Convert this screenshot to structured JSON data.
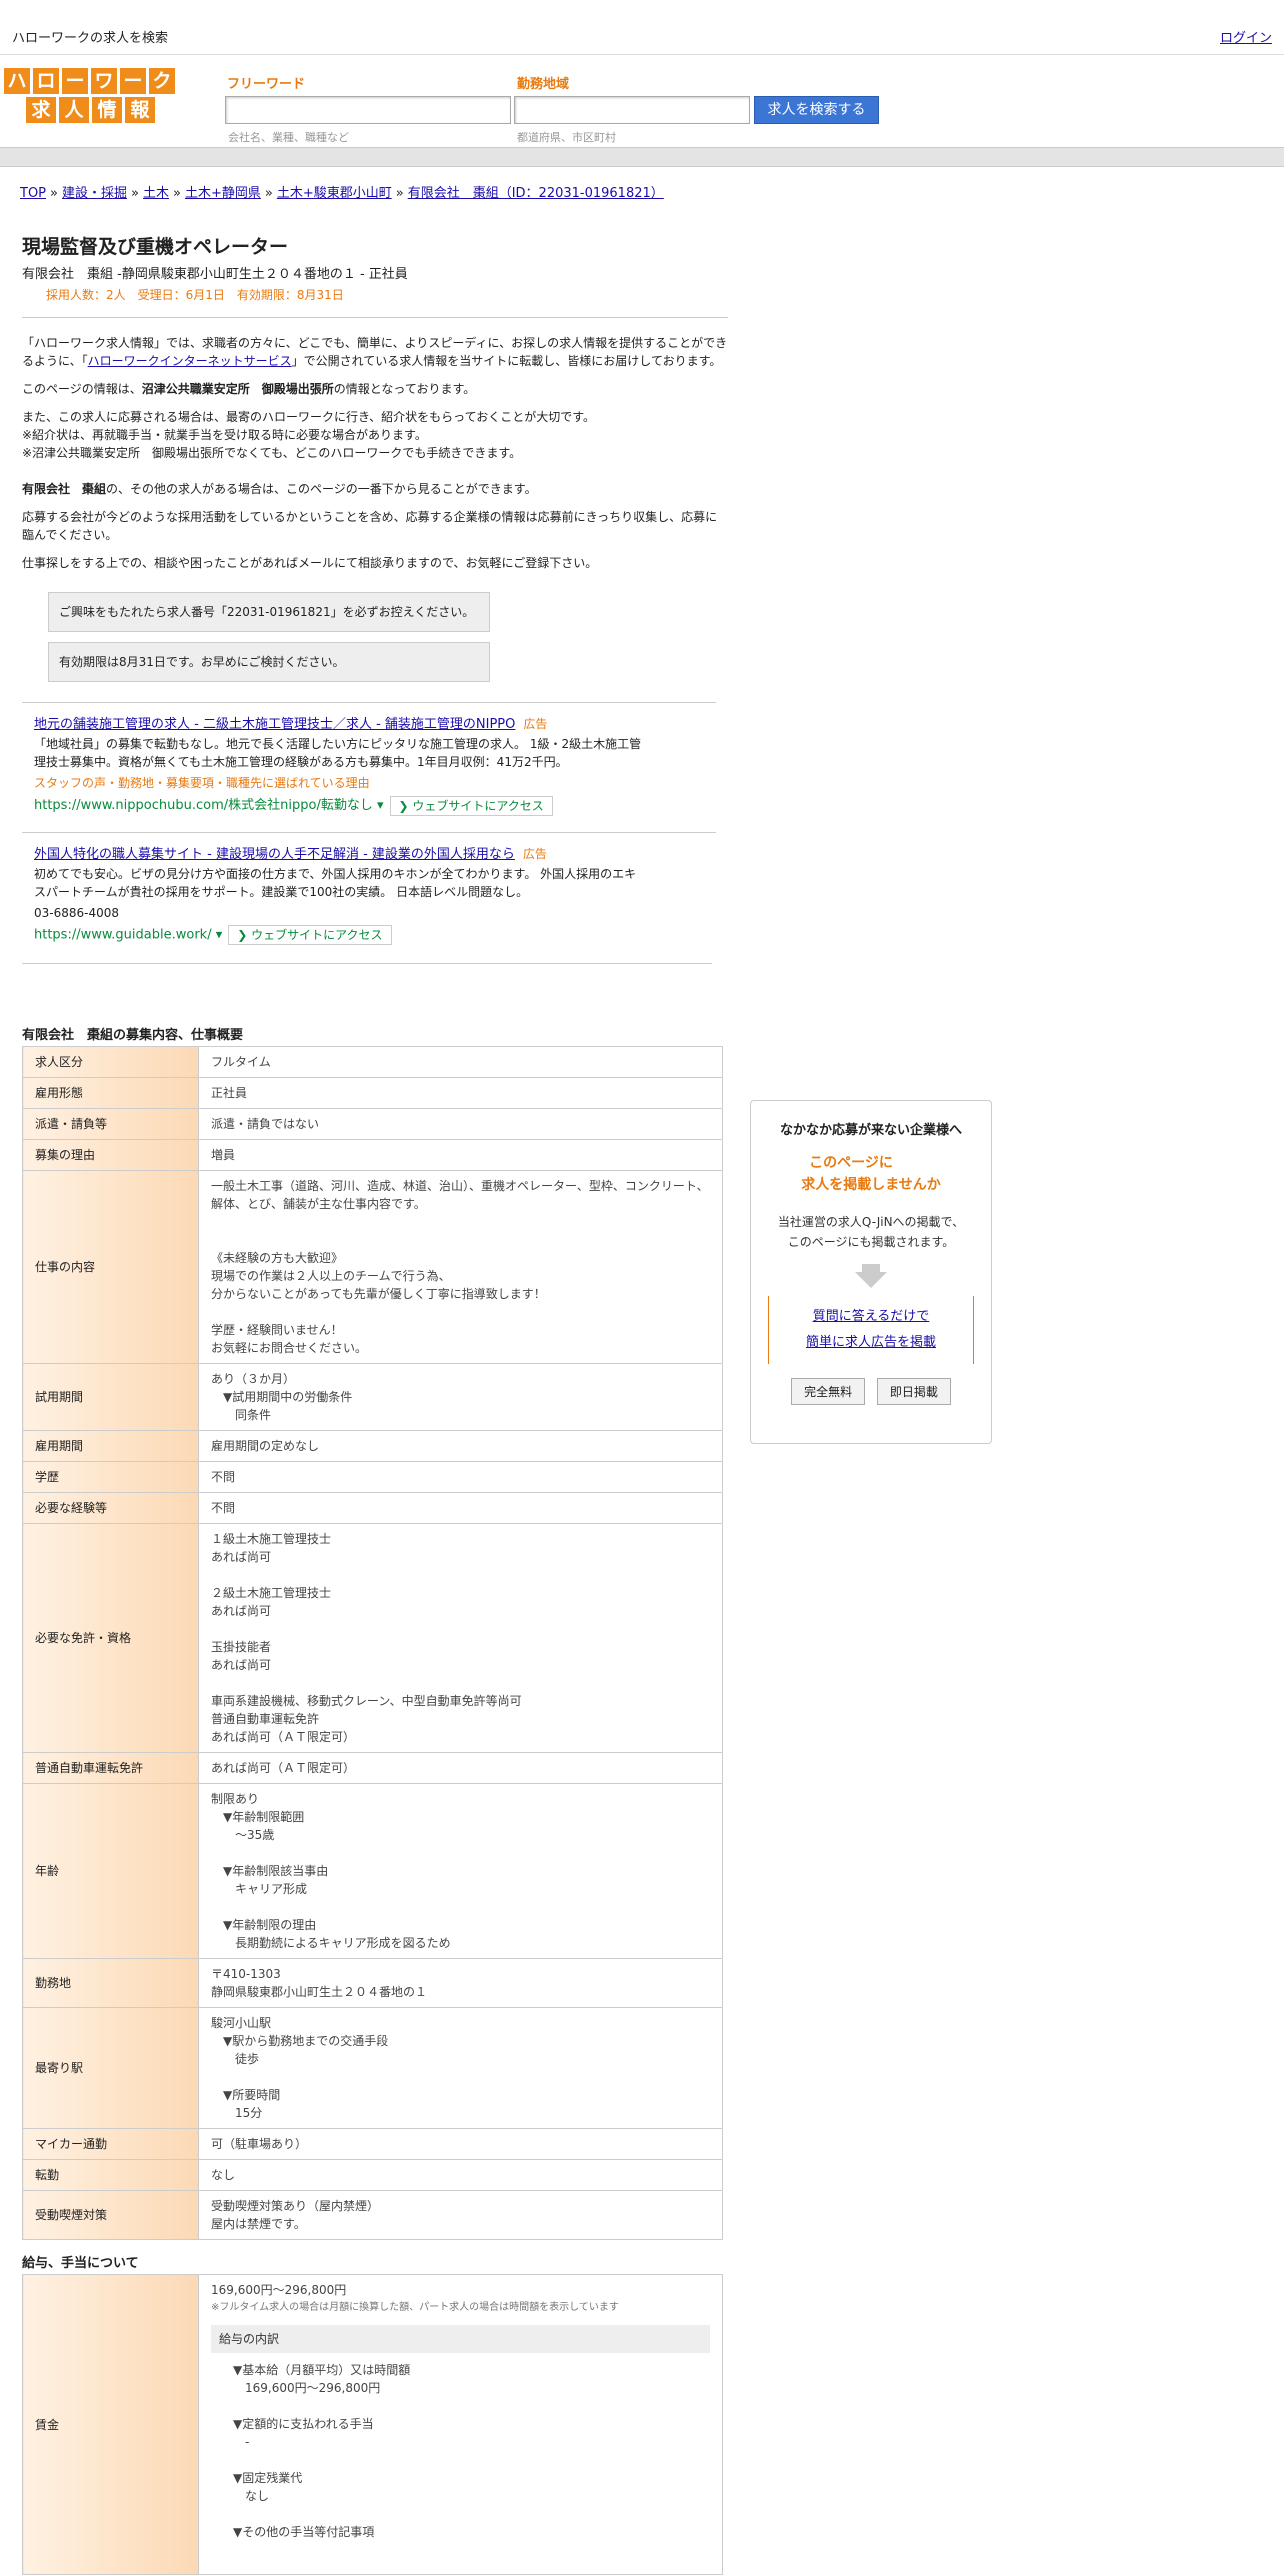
{
  "topbar": {
    "title": "ハローワークの求人を検索",
    "login": "ログイン"
  },
  "logo": {
    "row1": [
      "ハ",
      "ロ",
      "ー",
      "ワ",
      "ー",
      "ク"
    ],
    "row2": [
      "求",
      "人",
      "情",
      "報"
    ]
  },
  "search": {
    "freeword_label": "フリーワード",
    "freeword_hint": "会社名、業種、職種など",
    "area_label": "勤務地域",
    "area_hint": "都道府県、市区町村",
    "button": "求人を検索する"
  },
  "breadcrumb": [
    "TOP",
    "建設・採掘",
    "土木",
    "土木+静岡県",
    "土木+駿東郡小山町",
    "有限会社　棗組（ID：22031-01961821）"
  ],
  "job": {
    "title": "現場監督及び重機オペレーター",
    "subtitle": "有限会社　棗組 -静岡県駿東郡小山町生土２０４番地の１ - 正社員",
    "meta": "採用人数：2人　受理日：6月1日　有効期限：8月31日"
  },
  "intro": {
    "p1_a": "「ハローワーク求人情報」では、求職者の方々に、どこでも、簡単に、よりスピーディに、お探しの求人情報を提供することができるように、「",
    "p1_link": "ハローワークインターネットサービス",
    "p1_b": "」で公開されている求人情報を当サイトに転載し、皆様にお届けしております。",
    "p2_a": "このページの情報は、",
    "p2_b": "沼津公共職業安定所　御殿場出張所",
    "p2_c": "の情報となっております。",
    "p3": "また、この求人に応募される場合は、最寄のハローワークに行き、紹介状をもらっておくことが大切です。\n※紹介状は、再就職手当・就業手当を受け取る時に必要な場合があります。\n※沼津公共職業安定所　御殿場出張所でなくても、どこのハローワークでも手続きできます。",
    "p4_a": "有限会社　棗組",
    "p4_b": "の、その他の求人がある場合は、このページの一番下から見ることができます。",
    "p5": "応募する会社が今どのような採用活動をしているかということを含め、応募する企業様の情報は応募前にきっちり収集し、応募に臨んでください。",
    "p6": "仕事探しをする上での、相談や困ったことがあればメールにて相談承りますので、お気軽にご登録下さい。"
  },
  "notices": [
    "ご興味をもたれたら求人番号「22031-01961821」を必ずお控えください。",
    "有効期限は8月31日です。お早めにご検討ください。"
  ],
  "ads": [
    {
      "title": "地元の舗装施工管理の求人 - 二級土木施工管理技士／求人 - 舗装施工管理のNIPPO",
      "tag": "広告",
      "desc": "「地域社員」の募集で転勤もなし。地元で長く活躍したい方にピッタリな施工管理の求人。 1級・2級土木施工管理技士募集中。資格が無くても土木施工管理の経験がある方も募集中。1年目月収例：41万2千円。",
      "orange": "スタッフの声・勤務地・募集要項・職種先に選ばれている理由",
      "url": "https://www.nippochubu.com/株式会社nippo/転勤なし",
      "button": "ウェブサイトにアクセス"
    },
    {
      "title": "外国人特化の職人募集サイト - 建設現場の人手不足解消 - 建設業の外国人採用なら",
      "tag": "広告",
      "desc": "初めてでも安心。ビザの見分け方や面接の仕方まで、外国人採用のキホンが全てわかります。 外国人採用のエキスパートチームが貴社の採用をサポート。建設業で100社の実績。 日本語レベル問題なし。",
      "phone": "03-6886-4008",
      "url": "https://www.guidable.work/",
      "button": "ウェブサイトにアクセス"
    }
  ],
  "section1": {
    "title": "有限会社　棗組の募集内容、仕事概要",
    "rows": [
      {
        "label": "求人区分",
        "value": "フルタイム"
      },
      {
        "label": "雇用形態",
        "value": "正社員"
      },
      {
        "label": "派遣・請負等",
        "value": "派遣・請負ではない"
      },
      {
        "label": "募集の理由",
        "value": "増員"
      },
      {
        "label": "仕事の内容",
        "value": "一般土木工事（道路、河川、造成、林道、治山）、重機オペレーター、型枠、コンクリート、解体、とび、舗装が主な仕事内容です。\n\n\n《未経験の方も大歓迎》\n現場での作業は２人以上のチームで行う為、\n分からないことがあっても先輩が優しく丁寧に指導致します！\n\n学歴・経験問いません！\nお気軽にお問合せください。"
      },
      {
        "label": "試用期間",
        "value": "あり（３か月）\n　▼試用期間中の労働条件\n　　同条件"
      },
      {
        "label": "雇用期間",
        "value": "雇用期間の定めなし"
      },
      {
        "label": "学歴",
        "value": "不問"
      },
      {
        "label": "必要な経験等",
        "value": "不問"
      },
      {
        "label": "必要な免許・資格",
        "value": "１級土木施工管理技士\nあれば尚可\n\n２級土木施工管理技士\nあれば尚可\n\n玉掛技能者\nあれば尚可\n\n車両系建設機械、移動式クレーン、中型自動車免許等尚可\n普通自動車運転免許\nあれば尚可（ＡＴ限定可）"
      },
      {
        "label": "普通自動車運転免許",
        "value": "あれば尚可（ＡＴ限定可）"
      },
      {
        "label": "年齢",
        "value": "制限あり\n　▼年齢制限範囲\n　　〜35歳\n\n　▼年齢制限該当事由\n　　キャリア形成\n\n　▼年齢制限の理由\n　　長期勤続によるキャリア形成を図るため"
      },
      {
        "label": "勤務地",
        "value": "〒410-1303\n静岡県駿東郡小山町生土２０４番地の１"
      },
      {
        "label": "最寄り駅",
        "value": "駿河小山駅\n　▼駅から勤務地までの交通手段\n　　徒歩\n\n　▼所要時間\n　　15分"
      },
      {
        "label": "マイカー通勤",
        "value": "可（駐車場あり）"
      },
      {
        "label": "転勤",
        "value": "なし"
      },
      {
        "label": "受動喫煙対策",
        "value": "受動喫煙対策あり（屋内禁煙）\n屋内は禁煙です。"
      }
    ]
  },
  "section2": {
    "title": "給与、手当について",
    "wage_label": "賃金",
    "wage_range": "169,600円〜296,800円",
    "wage_note": "※フルタイム求人の場合は月額に換算した額、パート求人の場合は時間額を表示しています",
    "breakdown_title": "給与の内訳",
    "breakdown": "▼基本給（月額平均）又は時間額\n　169,600円〜296,800円\n\n▼定額的に支払われる手当\n　-\n\n▼固定残業代\n　なし\n\n▼その他の手当等付記事項"
  },
  "sidebar": {
    "title": "なかなか応募が来ない企業様へ",
    "orange1": "このページに",
    "orange2": "求人を掲載しませんか",
    "text": "当社運営の求人Q-JiNへの掲載で、\nこのページにも掲載されます。",
    "link1": "質問に答えるだけで",
    "link2": "簡単に求人広告を掲載",
    "btn1": "完全無料",
    "btn2": "即日掲載"
  }
}
